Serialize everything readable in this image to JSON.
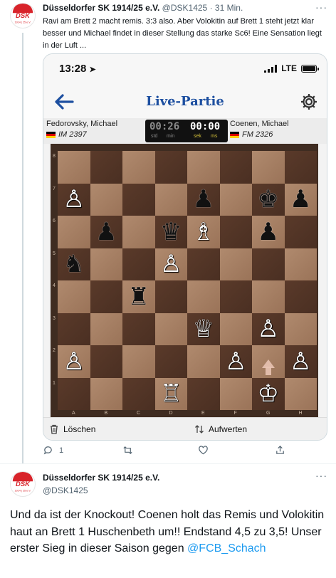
{
  "tweet1": {
    "author": "Düsseldorfer SK 1914/25 e.V.",
    "handle": "@DSK1425",
    "separator": "·",
    "time": "31 Min.",
    "more": "···",
    "text": "Ravi am Brett 2 macht remis. 3:3 also. Aber Volokitin auf Brett 1 steht jetzt klar besser und Michael findet in dieser Stellung das starke Sc6! Eine Sensation liegt in der Luft ...",
    "avatar_text": "DSK",
    "avatar_sub": "1914 | 25 e.V.",
    "actions": {
      "reply_count": "1",
      "retweet_count": "",
      "like_count": ""
    }
  },
  "screenshot": {
    "status_time": "13:28",
    "network": "LTE",
    "app_title": "Live-Partie",
    "player_white": {
      "name": "Fedorovsky, Michael",
      "rating": "IM 2397"
    },
    "player_black": {
      "name": "Coenen, Michael",
      "rating": "FM 2326"
    },
    "clock": {
      "left_time": "00:26",
      "right_time": "00:00",
      "left_labels": [
        "std",
        "min"
      ],
      "right_labels": [
        "sek",
        "ms"
      ]
    },
    "ranks": [
      "8",
      "7",
      "6",
      "5",
      "4",
      "3",
      "2",
      "1"
    ],
    "files": [
      "A",
      "B",
      "C",
      "D",
      "E",
      "F",
      "G",
      "H"
    ],
    "board": [
      [
        "",
        "",
        "",
        "",
        "",
        "",
        "",
        ""
      ],
      [
        "wP",
        "",
        "",
        "",
        "bP",
        "",
        "bK",
        "bP"
      ],
      [
        "",
        "bP",
        "",
        "bQ",
        "wB",
        "",
        "bP",
        ""
      ],
      [
        "bN",
        "",
        "",
        "wP",
        "",
        "",
        "",
        ""
      ],
      [
        "",
        "",
        "bR",
        "",
        "",
        "",
        "",
        ""
      ],
      [
        "",
        "",
        "",
        "",
        "wQ",
        "",
        "wP",
        ""
      ],
      [
        "wP",
        "",
        "",
        "",
        "",
        "wP",
        "ghost",
        "wP"
      ],
      [
        "",
        "",
        "",
        "wR",
        "",
        "",
        "wK",
        ""
      ]
    ],
    "piece_glyphs": {
      "wK": "♔",
      "wQ": "♕",
      "wR": "♖",
      "wB": "♗",
      "wN": "♘",
      "wP": "♙",
      "bK": "♚",
      "bQ": "♛",
      "bR": "♜",
      "bB": "♝",
      "bN": "♞",
      "bP": "♟"
    },
    "bottom_left_label": "Löschen",
    "bottom_right_label": "Aufwerten",
    "colors": {
      "app_blue": "#1d4fa0",
      "board_dark": "#4a2f22",
      "board_light": "#a27c60"
    }
  },
  "tweet2": {
    "author": "Düsseldorfer SK 1914/25 e.V.",
    "handle": "@DSK1425",
    "more": "···",
    "text_before_mention": "Und da ist der Knockout! Coenen holt das Remis und Volokitin haut an Brett 1 Huschenbeth um!! Endstand 4,5 zu 3,5! Unser erster Sieg in dieser Saison gegen ",
    "mention": "@FCB_Schach"
  },
  "colors": {
    "link_blue": "#1d9bf0",
    "muted": "#536471"
  }
}
